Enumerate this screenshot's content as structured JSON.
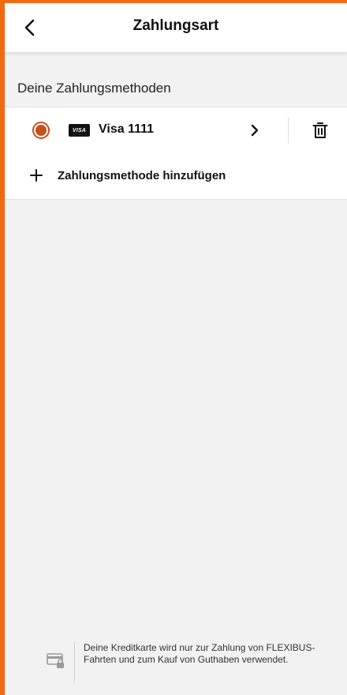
{
  "header": {
    "title": "Zahlungsart",
    "back_icon": "chevron-left-icon"
  },
  "section": {
    "title": "Deine Zahlungsmethoden"
  },
  "payment_methods": [
    {
      "brand": "VISA",
      "label": "Visa 1111",
      "selected": true
    }
  ],
  "add_method": {
    "label": "Zahlungsmethode hinzufügen",
    "icon": "plus-icon"
  },
  "info": {
    "text": "Deine Kreditkarte wird nur zur Zahlung von FLEXIBUS-Fahrten und zum Kauf von Guthaben verwendet.",
    "icon": "card-lock-icon"
  },
  "colors": {
    "accent": "#ef6a12",
    "radio": "#c8501b",
    "background": "#f2f2f2"
  }
}
